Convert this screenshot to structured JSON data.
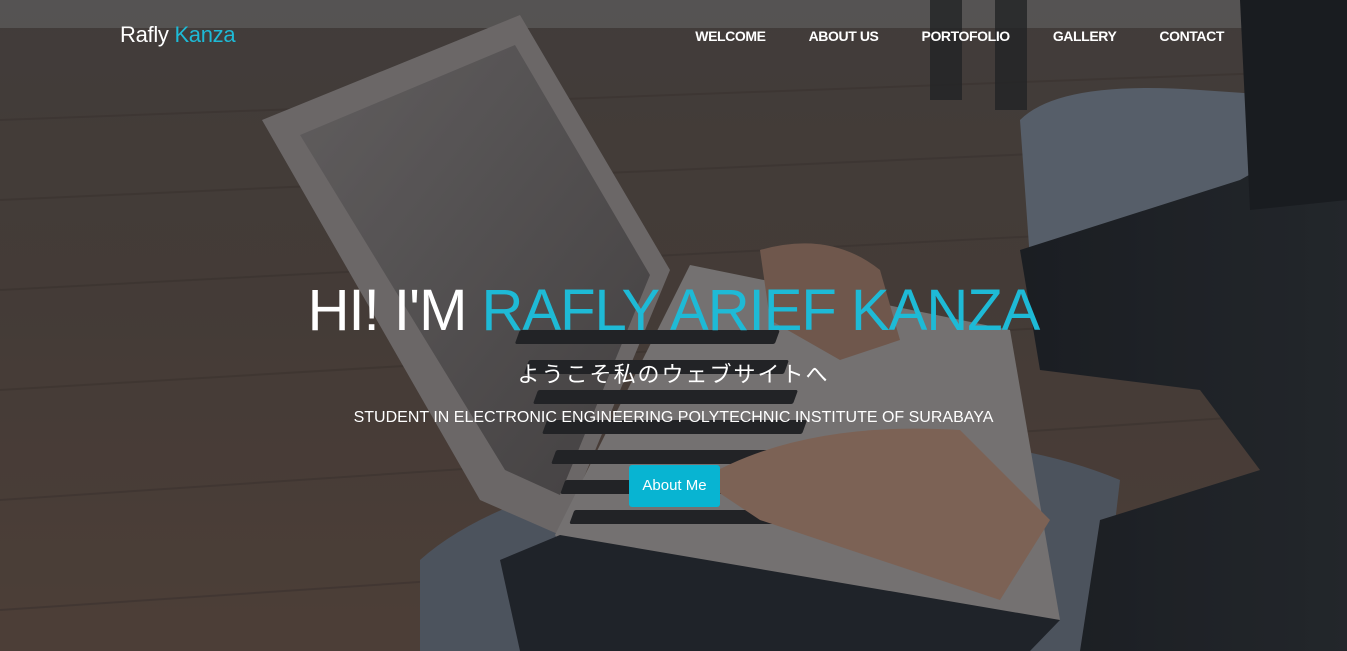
{
  "brand": {
    "first": "Rafly",
    "second": "Kanza"
  },
  "nav": {
    "items": [
      {
        "label": "WELCOME"
      },
      {
        "label": "ABOUT US"
      },
      {
        "label": "PORTOFOLIO"
      },
      {
        "label": "GALLERY"
      },
      {
        "label": "CONTACT"
      }
    ]
  },
  "hero": {
    "greeting": "HI! I'M",
    "name": "RAFLY ARIEF KANZA",
    "subtitle_jp": "ようこそ私のウェブサイトへ",
    "tagline": "STUDENT IN ELECTRONIC ENGINEERING POLYTECHNIC INSTITUTE OF SURABAYA",
    "button_label": "About Me",
    "background_image": "person typing on laptop"
  },
  "colors": {
    "accent": "#1ebad6",
    "button": "#08b4d2",
    "text": "#ffffff"
  }
}
